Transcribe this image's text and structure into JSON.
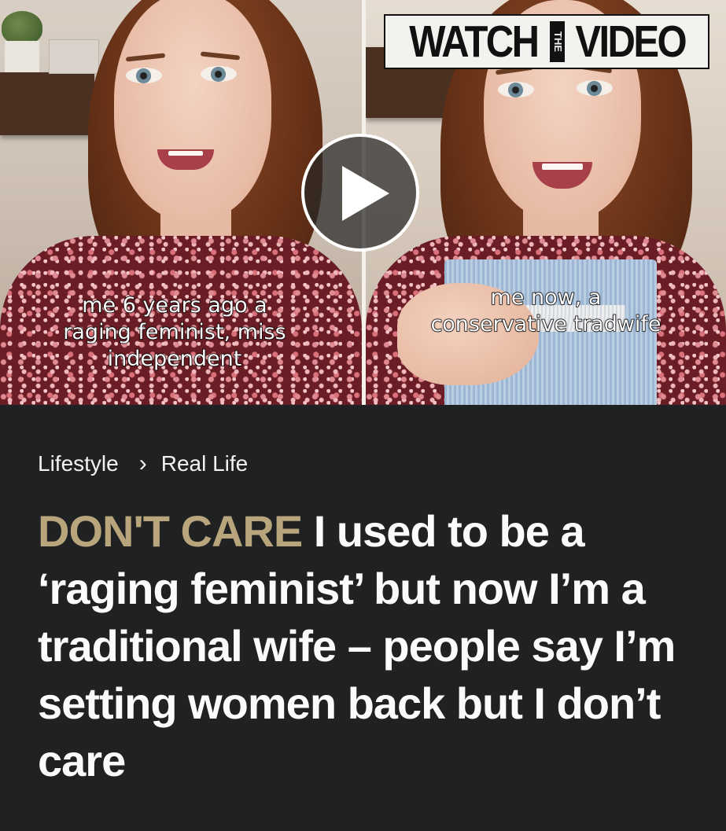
{
  "video": {
    "watch_badge": {
      "part1": "WATCH",
      "the": "THE",
      "part2": "VIDEO"
    },
    "left_caption": [
      "me 6 years ago a",
      "raging feminist, miss",
      "independent"
    ],
    "right_caption": [
      "me now, a",
      "conservative tradwife"
    ],
    "play_icon": "play-icon"
  },
  "breadcrumb": {
    "section": "Lifestyle",
    "separator": "›",
    "subsection": "Real Life"
  },
  "headline": {
    "kicker": "DON'T CARE",
    "text": " I used to be a ‘raging feminist’ but now I’m a traditional wife – people say I’m setting women back but I don’t care"
  },
  "colors": {
    "background": "#1f2123",
    "kicker": "#b8a57c",
    "headline": "#fbfbfb"
  }
}
